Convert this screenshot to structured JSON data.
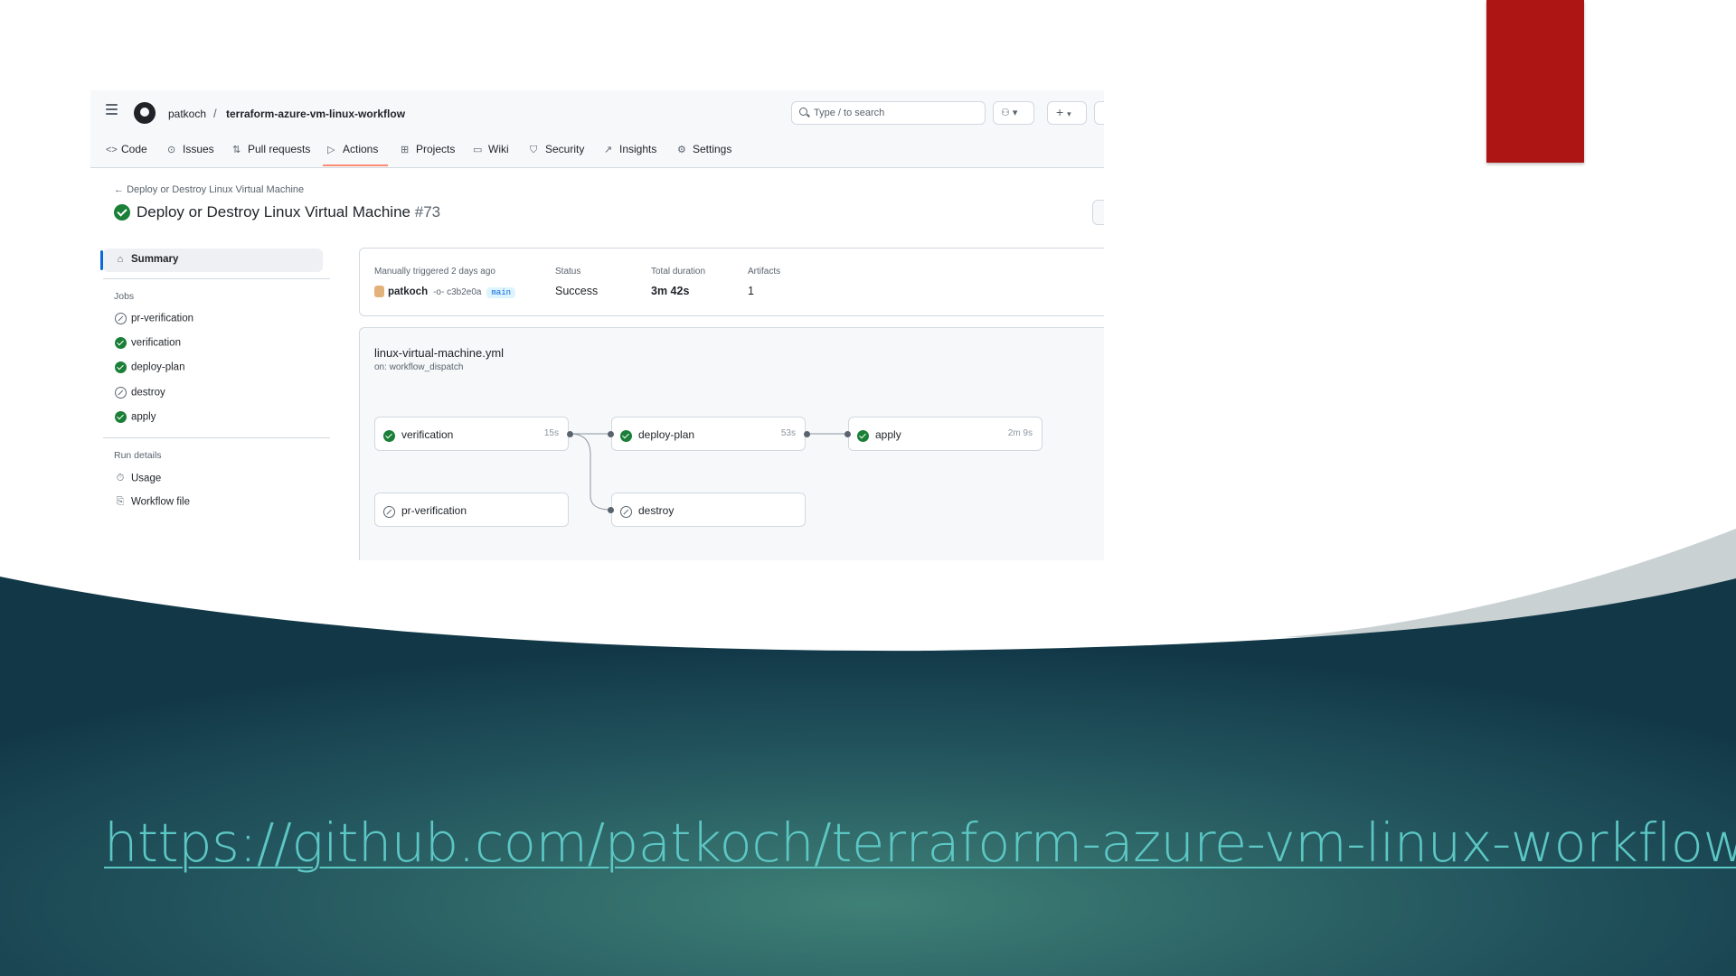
{
  "link": {
    "url_text": "https://github.com/patkoch/terraform-azure-vm-linux-workflow"
  },
  "colors": {
    "accent_red": "#ad1515",
    "teal_dark": "#163e4d",
    "teal_light": "#3f8076",
    "link": "#5cc7c4",
    "success_green": "#1a7f37"
  },
  "header": {
    "owner": "patkoch",
    "separator": "/",
    "repo": "terraform-azure-vm-linux-workflow",
    "search_placeholder": "Type / to search",
    "plus": "+"
  },
  "tabs": [
    {
      "label": "Code",
      "icon": "code-icon"
    },
    {
      "label": "Issues",
      "icon": "issue-icon"
    },
    {
      "label": "Pull requests",
      "icon": "pull-request-icon"
    },
    {
      "label": "Actions",
      "icon": "play-icon",
      "active": true
    },
    {
      "label": "Projects",
      "icon": "table-icon"
    },
    {
      "label": "Wiki",
      "icon": "book-icon"
    },
    {
      "label": "Security",
      "icon": "shield-icon"
    },
    {
      "label": "Insights",
      "icon": "graph-icon"
    },
    {
      "label": "Settings",
      "icon": "gear-icon"
    }
  ],
  "run": {
    "back_label": "Deploy or Destroy Linux Virtual Machine",
    "title": "Deploy or Destroy Linux Virtual Machine",
    "number": "#73"
  },
  "sidebar": {
    "summary": "Summary",
    "jobs_heading": "Jobs",
    "jobs": [
      {
        "label": "pr-verification",
        "status": "skipped"
      },
      {
        "label": "verification",
        "status": "success"
      },
      {
        "label": "deploy-plan",
        "status": "success"
      },
      {
        "label": "destroy",
        "status": "skipped"
      },
      {
        "label": "apply",
        "status": "success"
      }
    ],
    "run_details_heading": "Run details",
    "usage": "Usage",
    "workflow_file": "Workflow file"
  },
  "summary": {
    "trigger_label": "Manually triggered 2 days ago",
    "actor": "patkoch",
    "commit": "-o- c3b2e0a",
    "branch": "main",
    "status_label": "Status",
    "status_value": "Success",
    "duration_label": "Total duration",
    "duration_value": "3m 42s",
    "artifacts_label": "Artifacts",
    "artifacts_value": "1"
  },
  "graph": {
    "workflow_file": "linux-virtual-machine.yml",
    "on": "on: workflow_dispatch",
    "jobs": [
      {
        "label": "verification",
        "status": "success",
        "duration": "15s"
      },
      {
        "label": "deploy-plan",
        "status": "success",
        "duration": "53s"
      },
      {
        "label": "apply",
        "status": "success",
        "duration": "2m 9s"
      },
      {
        "label": "pr-verification",
        "status": "skipped",
        "duration": ""
      },
      {
        "label": "destroy",
        "status": "skipped",
        "duration": ""
      }
    ]
  }
}
